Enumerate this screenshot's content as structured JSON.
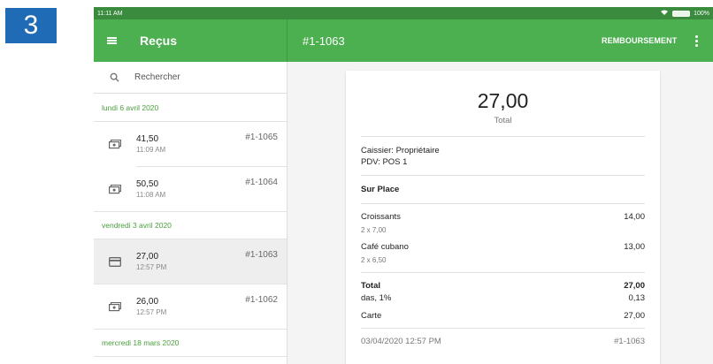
{
  "step_badge": "3",
  "status_bar": {
    "time": "11:11 AM",
    "battery": "100%"
  },
  "app_bar": {
    "title": "Reçus",
    "receipt_id": "#1-1063",
    "refund_label": "REMBOURSEMENT"
  },
  "sidebar": {
    "search_placeholder": "Rechercher",
    "groups": [
      {
        "date": "lundi 6 avril 2020",
        "receipts": [
          {
            "amount": "41,50",
            "time": "11:09 AM",
            "id": "#1-1065",
            "icon": "cash-icon"
          },
          {
            "amount": "50,50",
            "time": "11:08 AM",
            "id": "#1-1064",
            "icon": "cash-icon"
          }
        ]
      },
      {
        "date": "vendredi 3 avril 2020",
        "receipts": [
          {
            "amount": "27,00",
            "time": "12:57 PM",
            "id": "#1-1063",
            "icon": "card-icon"
          },
          {
            "amount": "26,00",
            "time": "12:57 PM",
            "id": "#1-1062",
            "icon": "cash-icon"
          }
        ]
      },
      {
        "date": "mercredi 18 mars 2020",
        "receipts": []
      }
    ]
  },
  "receipt": {
    "total_amount": "27,00",
    "total_label": "Total",
    "cashier": "Caissier: Propriétaire",
    "pos": "PDV: POS 1",
    "dining_option": "Sur Place",
    "items": [
      {
        "name": "Croissants",
        "price": "14,00",
        "detail": "2 x 7,00"
      },
      {
        "name": "Café cubano",
        "price": "13,00",
        "detail": "2 x 6,50"
      }
    ],
    "summary": [
      {
        "label": "Total",
        "value": "27,00",
        "bold": true
      },
      {
        "label": "das, 1%",
        "value": "0,13",
        "bold": false
      },
      {
        "label": "Carte",
        "value": "27,00",
        "bold": false
      }
    ],
    "footer_datetime": "03/04/2020 12:57 PM",
    "footer_id": "#1-1063"
  },
  "colors": {
    "appbar": "#4caf50",
    "status_bar": "#3a8b3e",
    "date_header_text": "#4a9e3d",
    "badge": "#1f6bb5"
  }
}
